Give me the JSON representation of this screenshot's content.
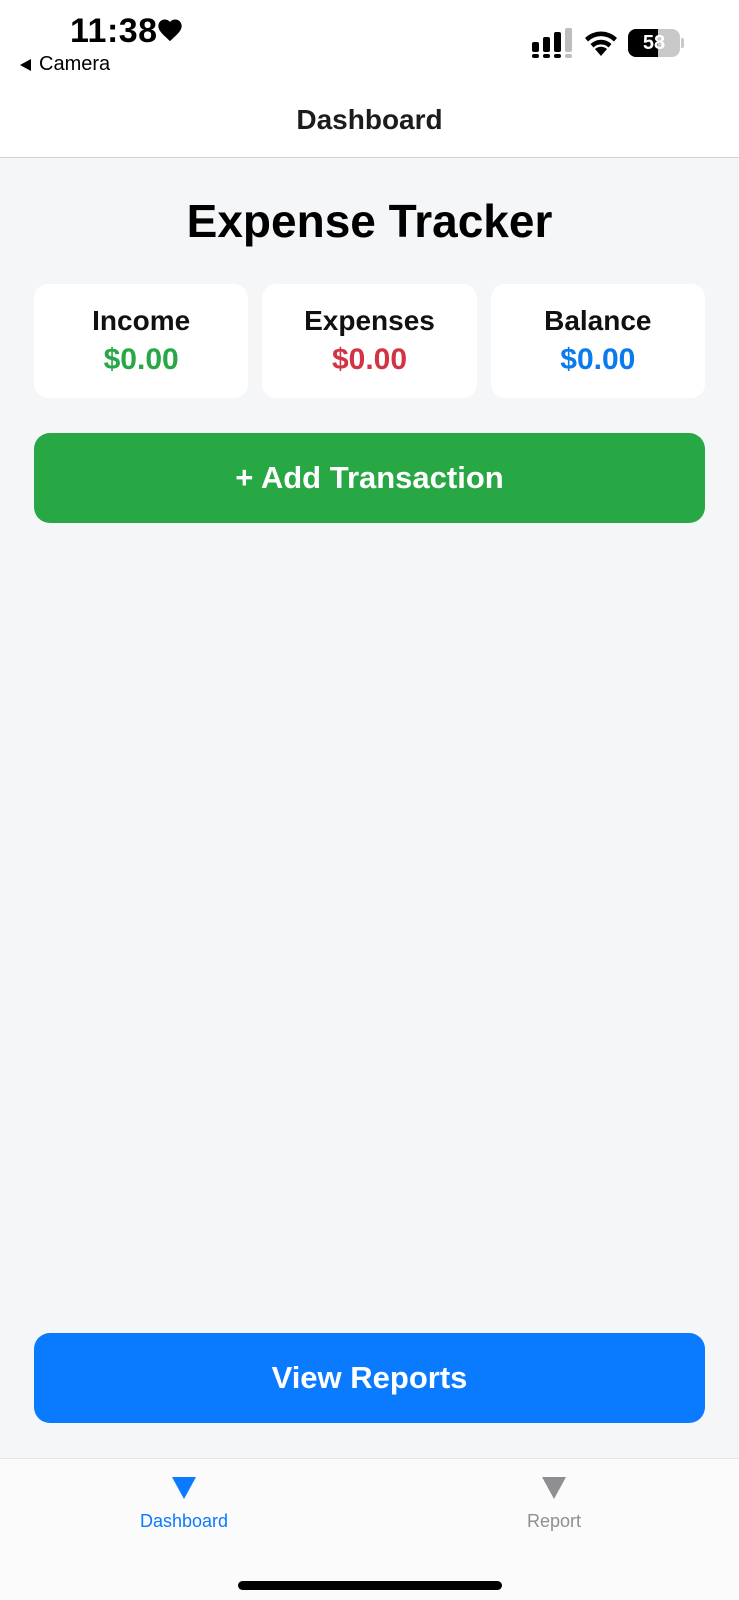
{
  "status_bar": {
    "time": "11:38",
    "back_app": "Camera",
    "battery": "58",
    "battery_level": 0.58
  },
  "nav": {
    "title": "Dashboard"
  },
  "main": {
    "title": "Expense Tracker",
    "cards": [
      {
        "label": "Income",
        "value": "$0.00",
        "color": "#28a745"
      },
      {
        "label": "Expenses",
        "value": "$0.00",
        "color": "#d13545"
      },
      {
        "label": "Balance",
        "value": "$0.00",
        "color": "#0a7aef"
      }
    ],
    "add_button": {
      "label": "+ Add Transaction",
      "color": "#28a745"
    },
    "reports_button": {
      "label": "View Reports",
      "color": "#0a7aff"
    }
  },
  "tab_bar": {
    "tabs": [
      {
        "label": "Dashboard",
        "icon": "triangle-down-icon",
        "active": true,
        "color": "#0a7aff"
      },
      {
        "label": "Report",
        "icon": "triangle-down-icon",
        "active": false,
        "color": "#8e8e93"
      }
    ]
  }
}
